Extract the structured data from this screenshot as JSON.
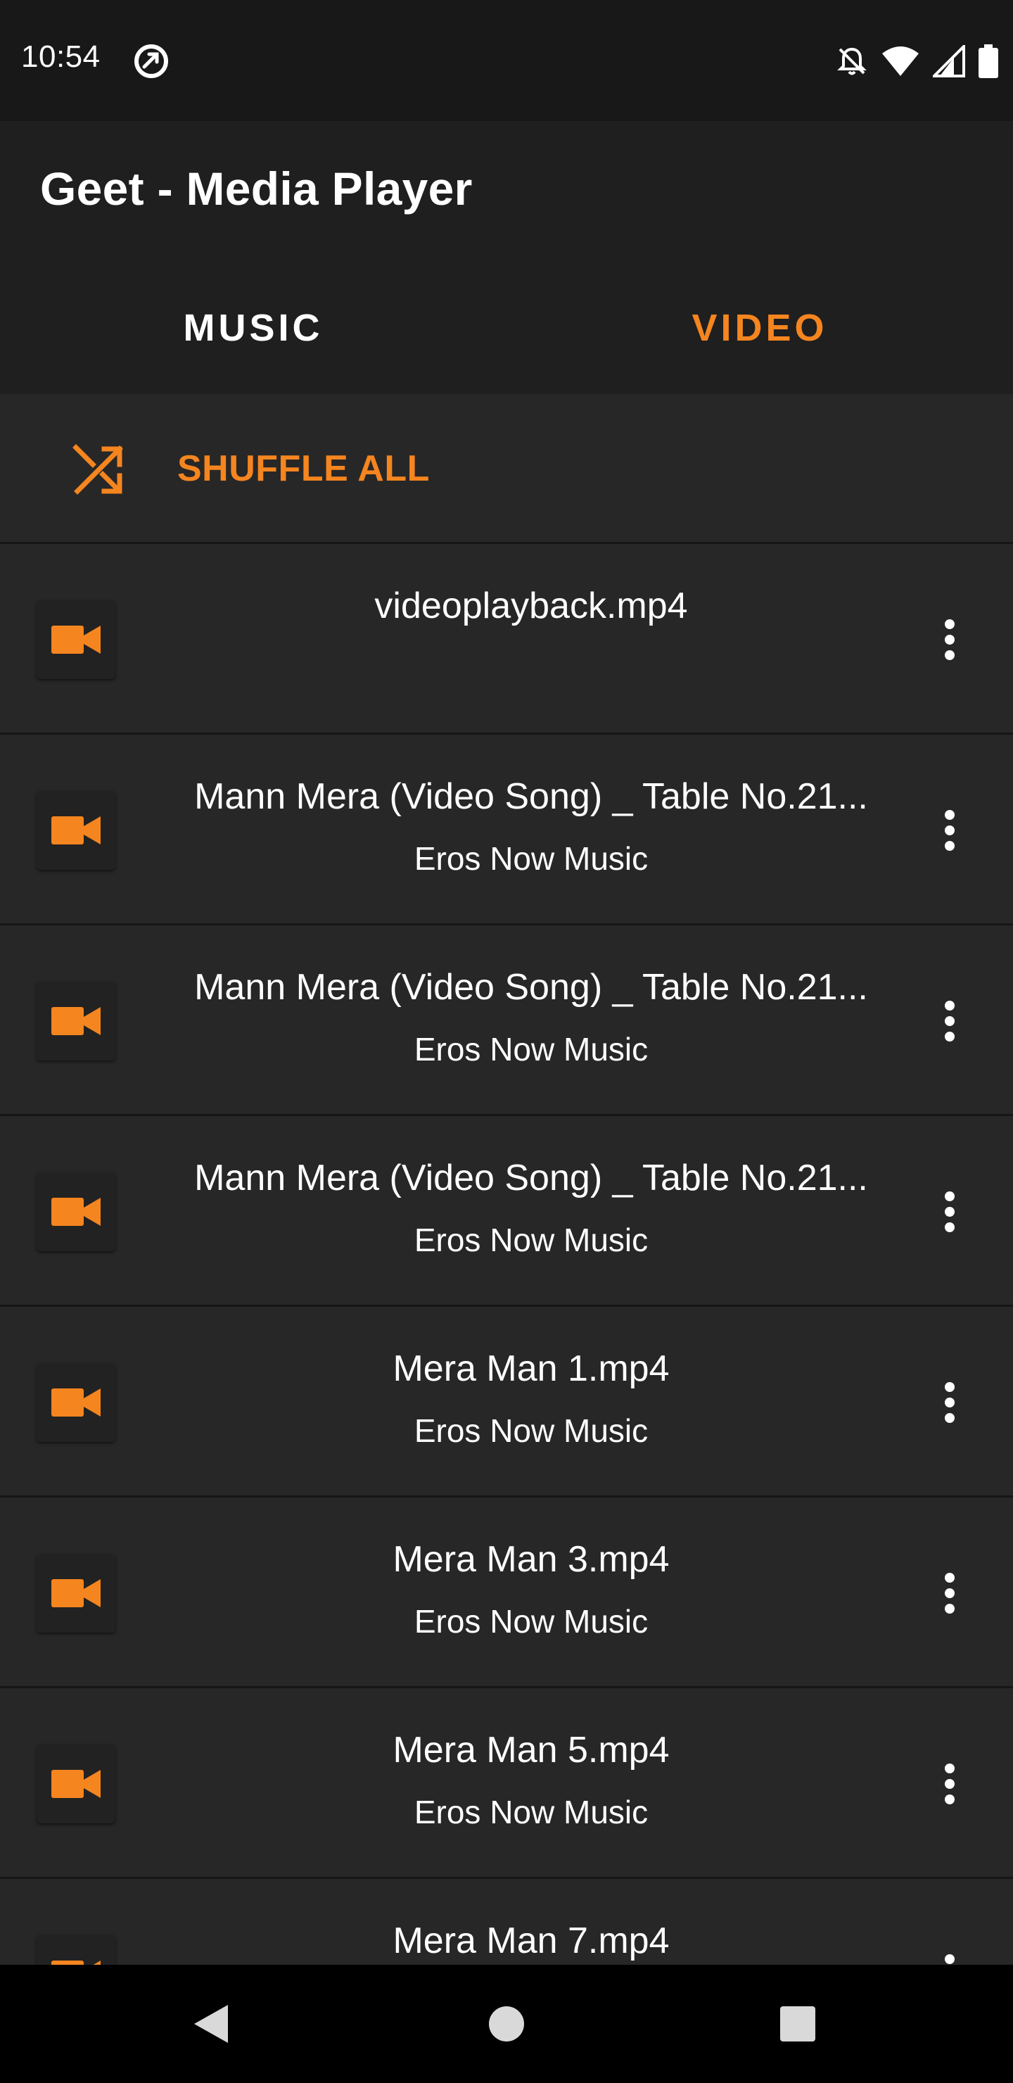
{
  "status_bar": {
    "time": "10:54",
    "icons": [
      "app-notification-icon",
      "notifications-off-icon",
      "wifi-icon",
      "signal-icon",
      "battery-icon"
    ]
  },
  "app_bar": {
    "title": "Geet - Media Player"
  },
  "tabs": [
    {
      "label": "MUSIC",
      "active": false
    },
    {
      "label": "VIDEO",
      "active": true
    }
  ],
  "shuffle": {
    "label": "SHUFFLE ALL",
    "icon": "shuffle-icon"
  },
  "videos": [
    {
      "title": "videoplayback.mp4",
      "artist": ""
    },
    {
      "title": "Mann Mera (Video Song) _ Table No.21...",
      "artist": "Eros Now Music"
    },
    {
      "title": "Mann Mera (Video Song) _ Table No.21...",
      "artist": "Eros Now Music"
    },
    {
      "title": "Mann Mera (Video Song) _ Table No.21...",
      "artist": "Eros Now Music"
    },
    {
      "title": "Mera Man 1.mp4",
      "artist": "Eros Now Music"
    },
    {
      "title": "Mera Man 3.mp4",
      "artist": "Eros Now Music"
    },
    {
      "title": "Mera Man 5.mp4",
      "artist": "Eros Now Music"
    },
    {
      "title": "Mera Man 7.mp4",
      "artist": ""
    }
  ],
  "colors": {
    "accent": "#f5851f",
    "background": "#262626",
    "toolbar": "#1f1f1f",
    "status_bar": "#181818"
  },
  "nav_bar": {
    "icons": [
      "back-icon",
      "home-icon",
      "recents-icon"
    ]
  }
}
